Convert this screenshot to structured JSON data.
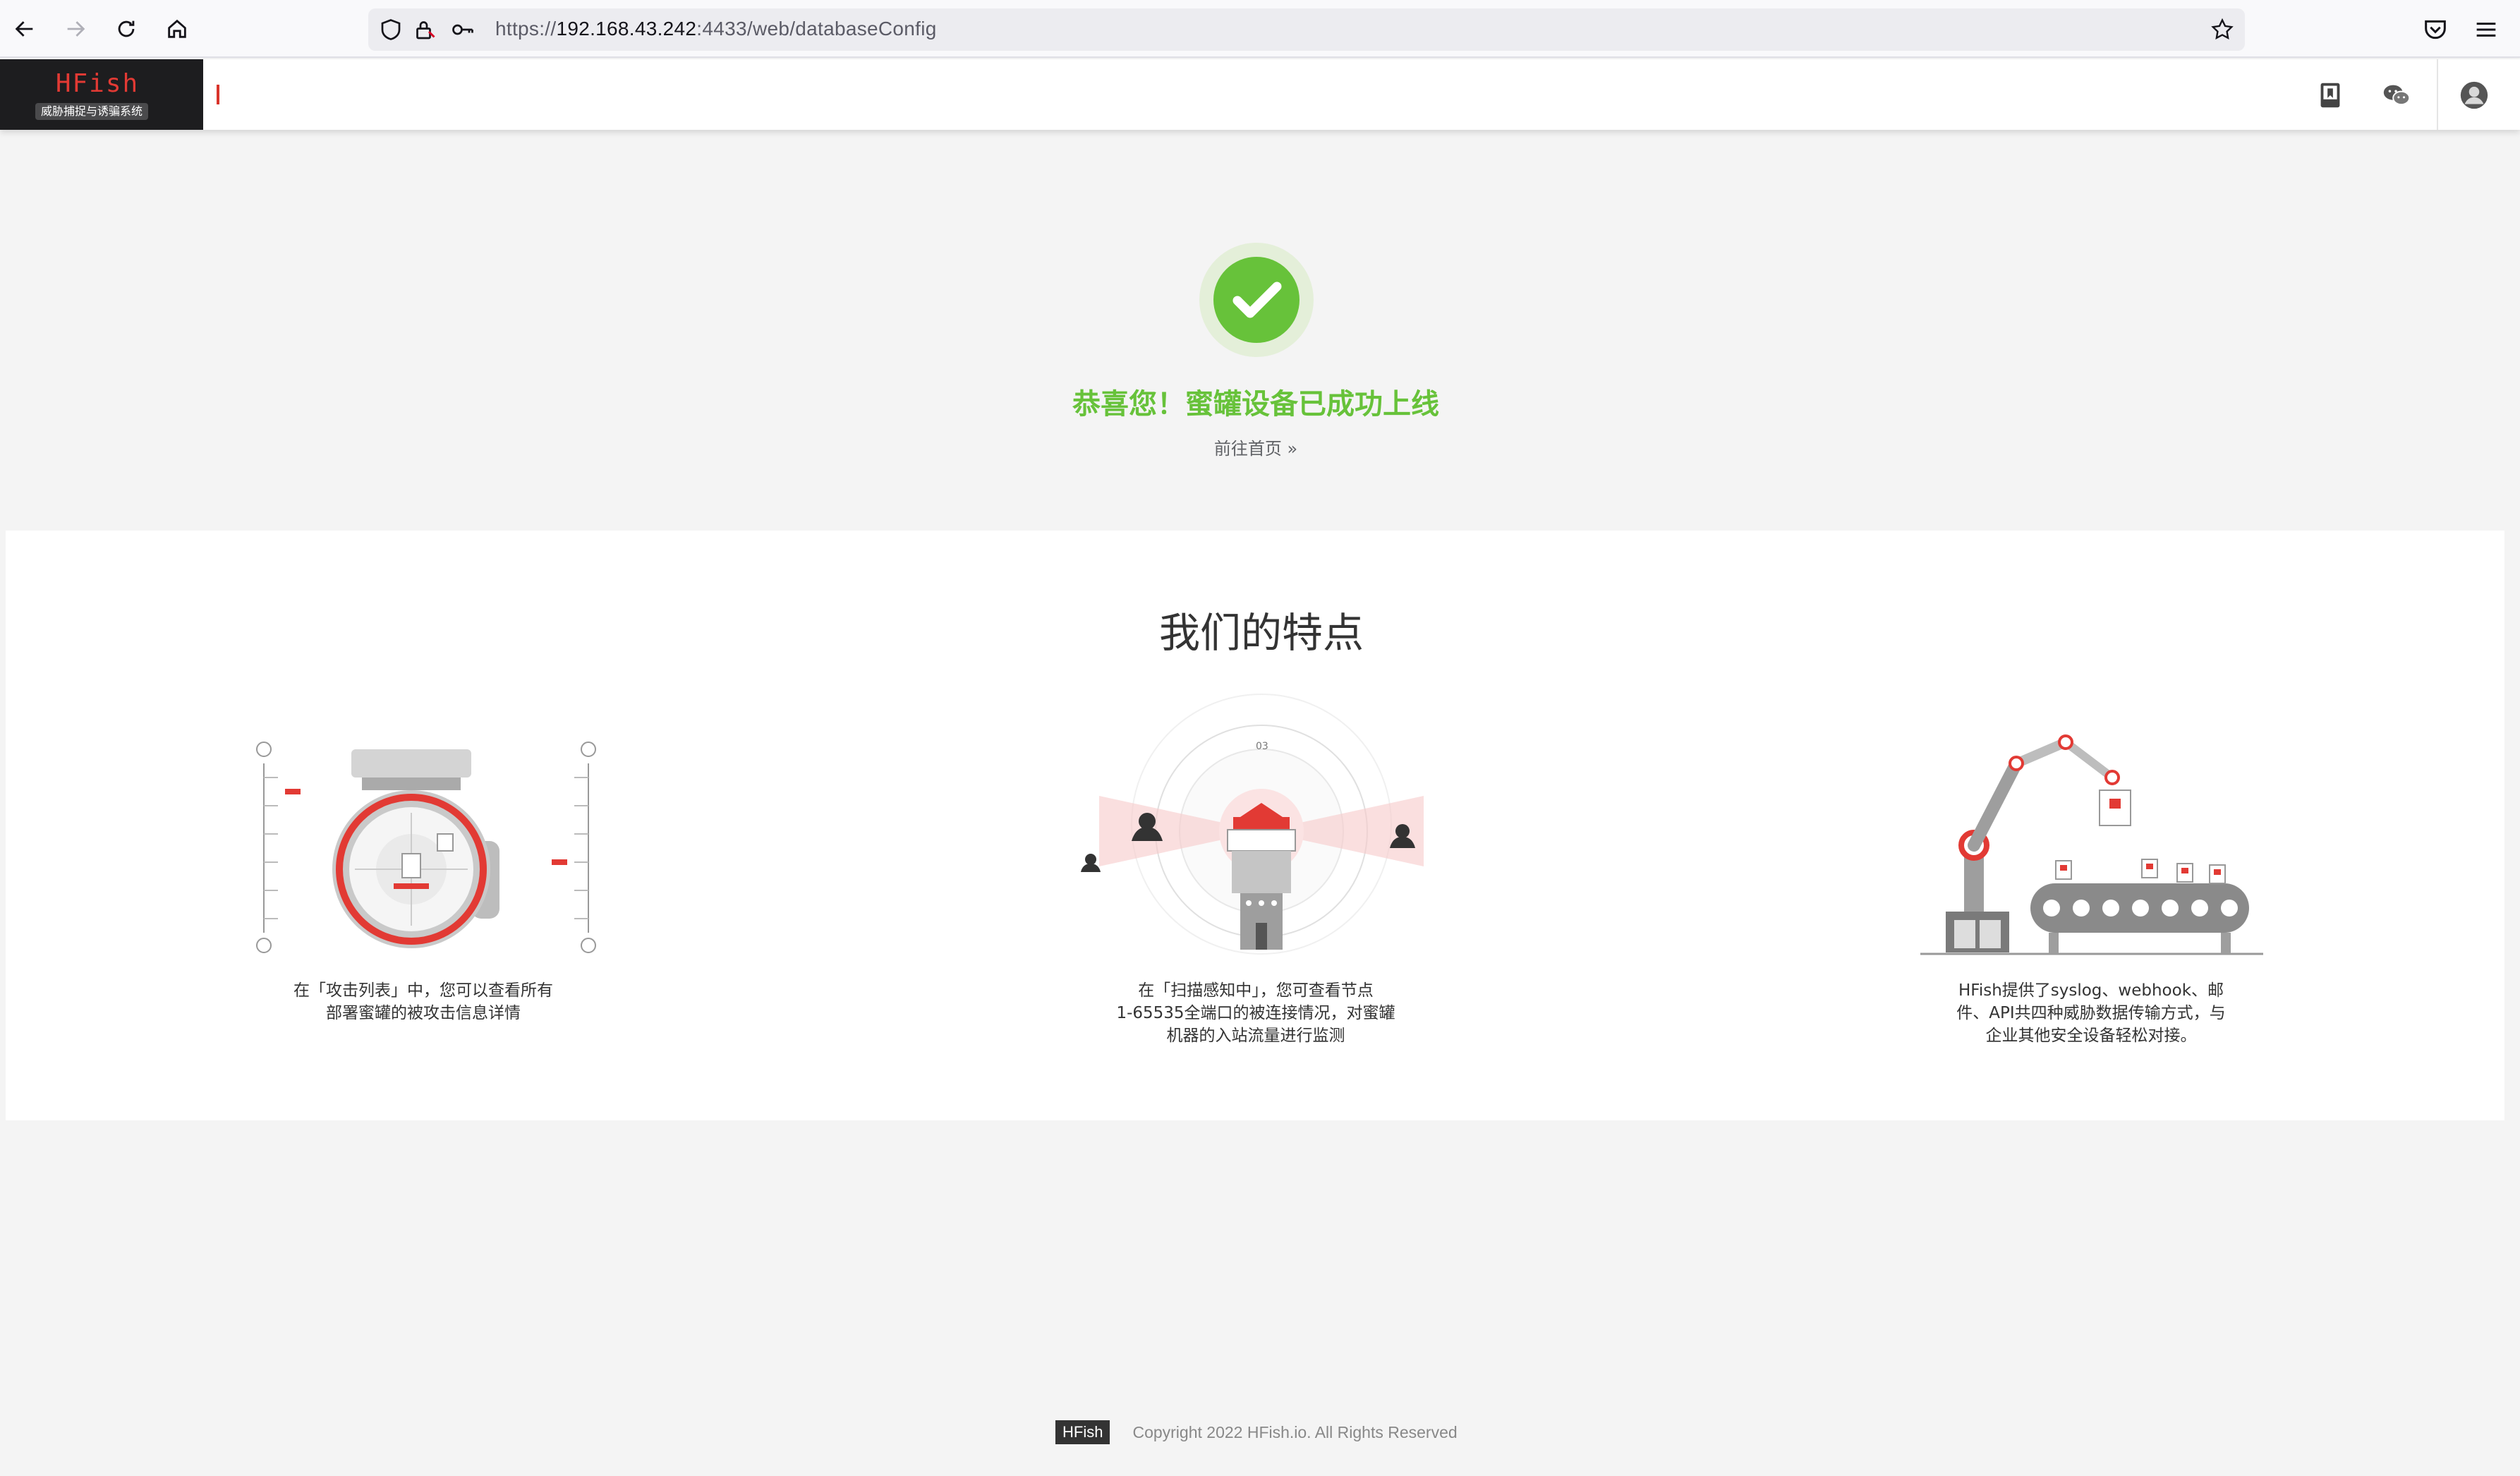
{
  "browser": {
    "url_scheme": "https://",
    "url_host": "192.168.43.242",
    "url_path": ":4433/web/databaseConfig",
    "icons": [
      "back-icon",
      "forward-icon",
      "reload-icon",
      "home-icon",
      "shield-icon",
      "lock-icon",
      "key-icon",
      "star-icon",
      "pocket-icon",
      "menu-icon"
    ]
  },
  "header": {
    "logo_title": "HFish",
    "logo_subtitle": "威胁捕捉与诱骗系统",
    "icons": [
      "docs-icon",
      "wechat-icon",
      "user-avatar-icon"
    ],
    "accent": "#e23a34"
  },
  "success": {
    "title": "恭喜您！蜜罐设备已成功上线",
    "home_link": "前往首页",
    "home_link_glyph": "»",
    "color": "#67c23a"
  },
  "features": {
    "title": "我们的特点",
    "items": [
      {
        "icon": "attack-list-illustration",
        "lines": [
          "在「攻击列表」中，您可以查看所有",
          "部署蜜罐的被攻击信息详情"
        ]
      },
      {
        "icon": "scan-tower-illustration",
        "lines": [
          "在「扫描感知中」，您可查看节点",
          "1-65535全端口的被连接情况，对蜜罐",
          "机器的入站流量进行监测"
        ]
      },
      {
        "icon": "robot-arm-illustration",
        "lines": [
          "HFish提供了syslog、webhook、邮",
          "件、API共四种威胁数据传输方式，与",
          "企业其他安全设备轻松对接。"
        ]
      }
    ]
  },
  "footer": {
    "badge": "HFish",
    "copyright": "Copyright 2022 HFish.io. All Rights Reserved"
  }
}
